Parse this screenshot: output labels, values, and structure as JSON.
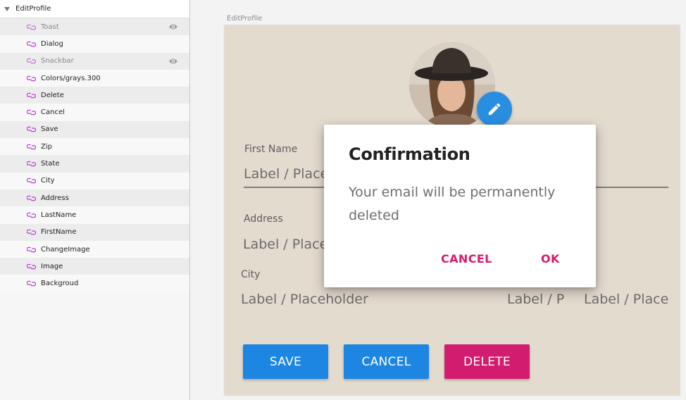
{
  "layers": {
    "group": {
      "label": "EditProfile",
      "icon": "disclosure-triangle-icon"
    },
    "items": [
      {
        "label": "Toast",
        "hidden": true
      },
      {
        "label": "Dialog",
        "hidden": false
      },
      {
        "label": "Snackbar",
        "hidden": true
      },
      {
        "label": "Colors/grays.300",
        "hidden": false
      },
      {
        "label": "Delete",
        "hidden": false
      },
      {
        "label": "Cancel",
        "hidden": false
      },
      {
        "label": "Save",
        "hidden": false
      },
      {
        "label": "Zip",
        "hidden": false
      },
      {
        "label": "State",
        "hidden": false
      },
      {
        "label": "City",
        "hidden": false
      },
      {
        "label": "Address",
        "hidden": false
      },
      {
        "label": "LastName",
        "hidden": false
      },
      {
        "label": "FirstName",
        "hidden": false
      },
      {
        "label": "ChangeImage",
        "hidden": false
      },
      {
        "label": "Image",
        "hidden": false
      },
      {
        "label": "Backgroud",
        "hidden": false
      }
    ],
    "item_icon": "symbol-instance-icon",
    "hidden_indicator_icon": "eye-icon",
    "symbol_color": "#b43fd0"
  },
  "artboard": {
    "title": "EditProfile",
    "background": "#e4dbcf"
  },
  "form": {
    "first_name": {
      "label": "First Name",
      "value": "Label / Placeholder"
    },
    "address": {
      "label": "Address",
      "value": "Label / Placeholder"
    },
    "city": {
      "label": "City",
      "value": "Label / Placeholder"
    },
    "state": {
      "value": "Label / Placeholder"
    },
    "zip": {
      "value": "Label / Placeholder"
    },
    "buttons": {
      "save": "SAVE",
      "cancel": "CANCEL",
      "delete": "DELETE"
    },
    "colors": {
      "primary": "#1c86e2",
      "danger": "#d21c6f"
    },
    "change_image_icon": "pencil-icon"
  },
  "dialog": {
    "title": "Confirmation",
    "message": "Your email will be permanently deleted",
    "cancel_label": "CANCEL",
    "ok_label": "OK",
    "action_color": "#d81b73"
  }
}
